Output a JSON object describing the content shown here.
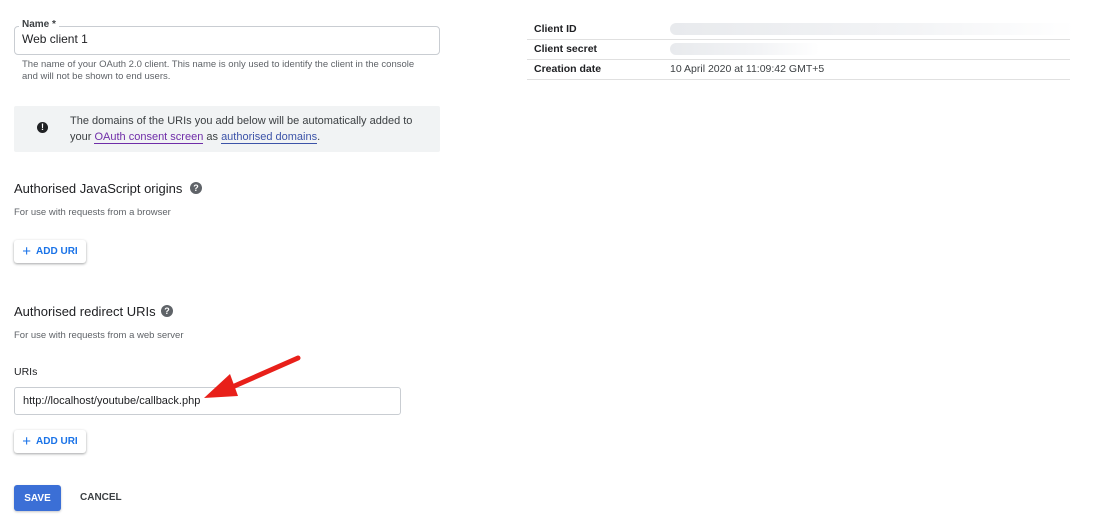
{
  "form": {
    "name_label": "Name *",
    "name_value": "Web client 1",
    "name_helper": "The name of your OAuth 2.0 client. This name is only used to identify the client in the console and will not be shown to end users.",
    "info_text_before": "The domains of the URIs you add below will be automatically added to your",
    "info_link_consent": "OAuth consent screen",
    "info_text_middle": "as",
    "info_link_domains": "authorised domains",
    "info_text_end": ".",
    "js_origins_title": "Authorised JavaScript origins",
    "js_origins_sub": "For use with requests from a browser",
    "redirect_title": "Authorised redirect URIs",
    "redirect_sub": "For use with requests from a web server",
    "uris_label": "URIs",
    "uri_value": "http://localhost/youtube/callback.php",
    "add_uri_label": "ADD URI",
    "save_label": "SAVE",
    "cancel_label": "CANCEL"
  },
  "details": {
    "rows": [
      {
        "key": "Client ID",
        "value": ""
      },
      {
        "key": "Client secret",
        "value": ""
      },
      {
        "key": "Creation date",
        "value": "10 April 2020 at 11:09:42 GMT+5"
      }
    ]
  },
  "icons": {
    "info": "info-icon",
    "help": "help-icon",
    "plus": "plus-icon"
  },
  "colors": {
    "accent": "#1a73e8",
    "save_button": "#3b6fd6",
    "annotation_arrow": "#e8201a"
  }
}
